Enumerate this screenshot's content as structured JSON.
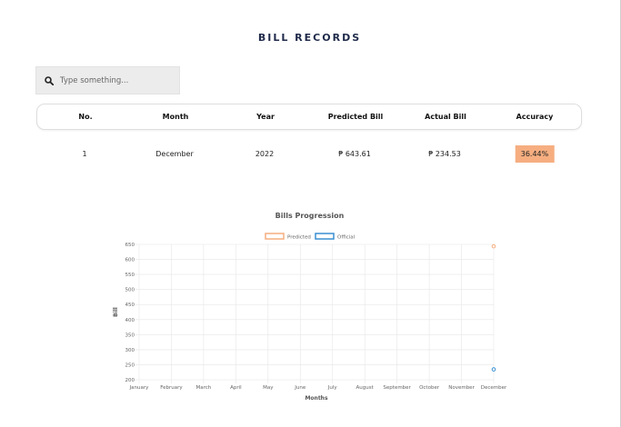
{
  "page": {
    "title": "BILL RECORDS"
  },
  "search": {
    "placeholder": "Type something..."
  },
  "table": {
    "headers": [
      "No.",
      "Month",
      "Year",
      "Predicted Bill",
      "Actual Bill",
      "Accuracy"
    ],
    "rows": [
      {
        "no": "1",
        "month": "December",
        "year": "2022",
        "predicted": "₱ 643.61",
        "actual": "₱ 234.53",
        "accuracy": "36.44%"
      }
    ]
  },
  "colors": {
    "accent": "#1f2a4a",
    "badge": "#f6ae80",
    "predicted": "#f6ae80",
    "official": "#3a8fd0"
  },
  "chart_data": {
    "type": "line",
    "title": "Bills Progression",
    "xlabel": "Months",
    "ylabel": "Bill",
    "categories": [
      "January",
      "February",
      "March",
      "April",
      "May",
      "June",
      "July",
      "August",
      "September",
      "October",
      "November",
      "December"
    ],
    "ylim": [
      200,
      650
    ],
    "yticks": [
      200,
      250,
      300,
      350,
      400,
      450,
      500,
      550,
      600,
      650
    ],
    "grid": true,
    "legend": "top",
    "series": [
      {
        "name": "Predicted",
        "color": "#f6ae80",
        "values": [
          null,
          null,
          null,
          null,
          null,
          null,
          null,
          null,
          null,
          null,
          null,
          643.61
        ]
      },
      {
        "name": "Official",
        "color": "#3a8fd0",
        "values": [
          null,
          null,
          null,
          null,
          null,
          null,
          null,
          null,
          null,
          null,
          null,
          234.53
        ]
      }
    ]
  }
}
